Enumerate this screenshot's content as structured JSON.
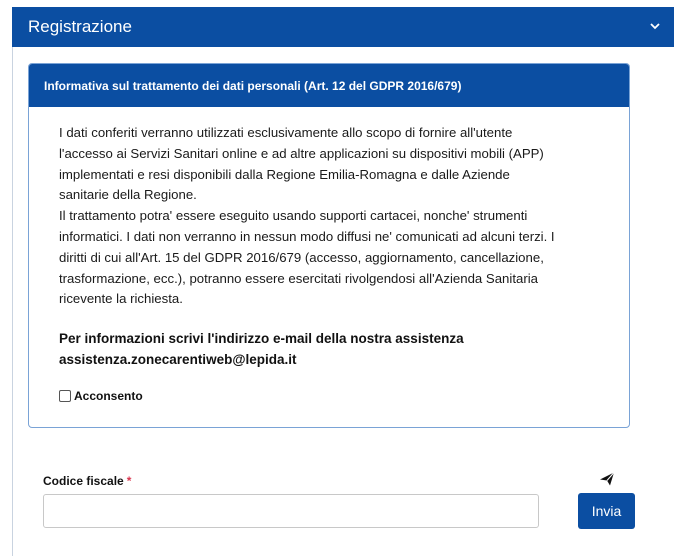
{
  "panel": {
    "title": "Registrazione",
    "toggle_icon": "chevron-down-icon"
  },
  "privacy": {
    "title": "Informativa sul trattamento dei dati personali (Art. 12 del GDPR 2016/679)",
    "text_lines": [
      "I dati conferiti verranno utilizzati esclusivamente allo scopo di fornire all'utente",
      "l'accesso ai Servizi Sanitari online e ad altre applicazioni su dispositivi mobili (APP)",
      "implementati e resi disponibili dalla Regione Emilia-Romagna e dalle Aziende",
      "sanitarie della Regione.",
      "Il trattamento potra' essere eseguito usando supporti cartacei, nonche' strumenti",
      "informatici. I dati non verranno in nessun modo diffusi ne' comunicati ad alcuni terzi. I",
      "diritti di cui all'Art. 15 del GDPR 2016/679 (accesso, aggiornamento, cancellazione,",
      "trasformazione, ecc.), potranno essere esercitati rivolgendosi all'Azienda Sanitaria",
      "ricevente la richiesta."
    ],
    "info_line1": "Per informazioni scrivi l'indirizzo e-mail della nostra assistenza",
    "info_email": "assistenza.zonecarentiweb@lepida.it",
    "consent_label": "Acconsento",
    "consent_checked": false
  },
  "form": {
    "fiscal_code_label": "Codice fiscale",
    "required_marker": "*",
    "fiscal_code_value": "",
    "fiscal_code_placeholder": "",
    "send_icon": "paper-plane-icon",
    "submit_label": "Invia"
  },
  "colors": {
    "primary": "#0b4ea2",
    "required": "#d9364f",
    "card_border": "#7aa3d6"
  }
}
